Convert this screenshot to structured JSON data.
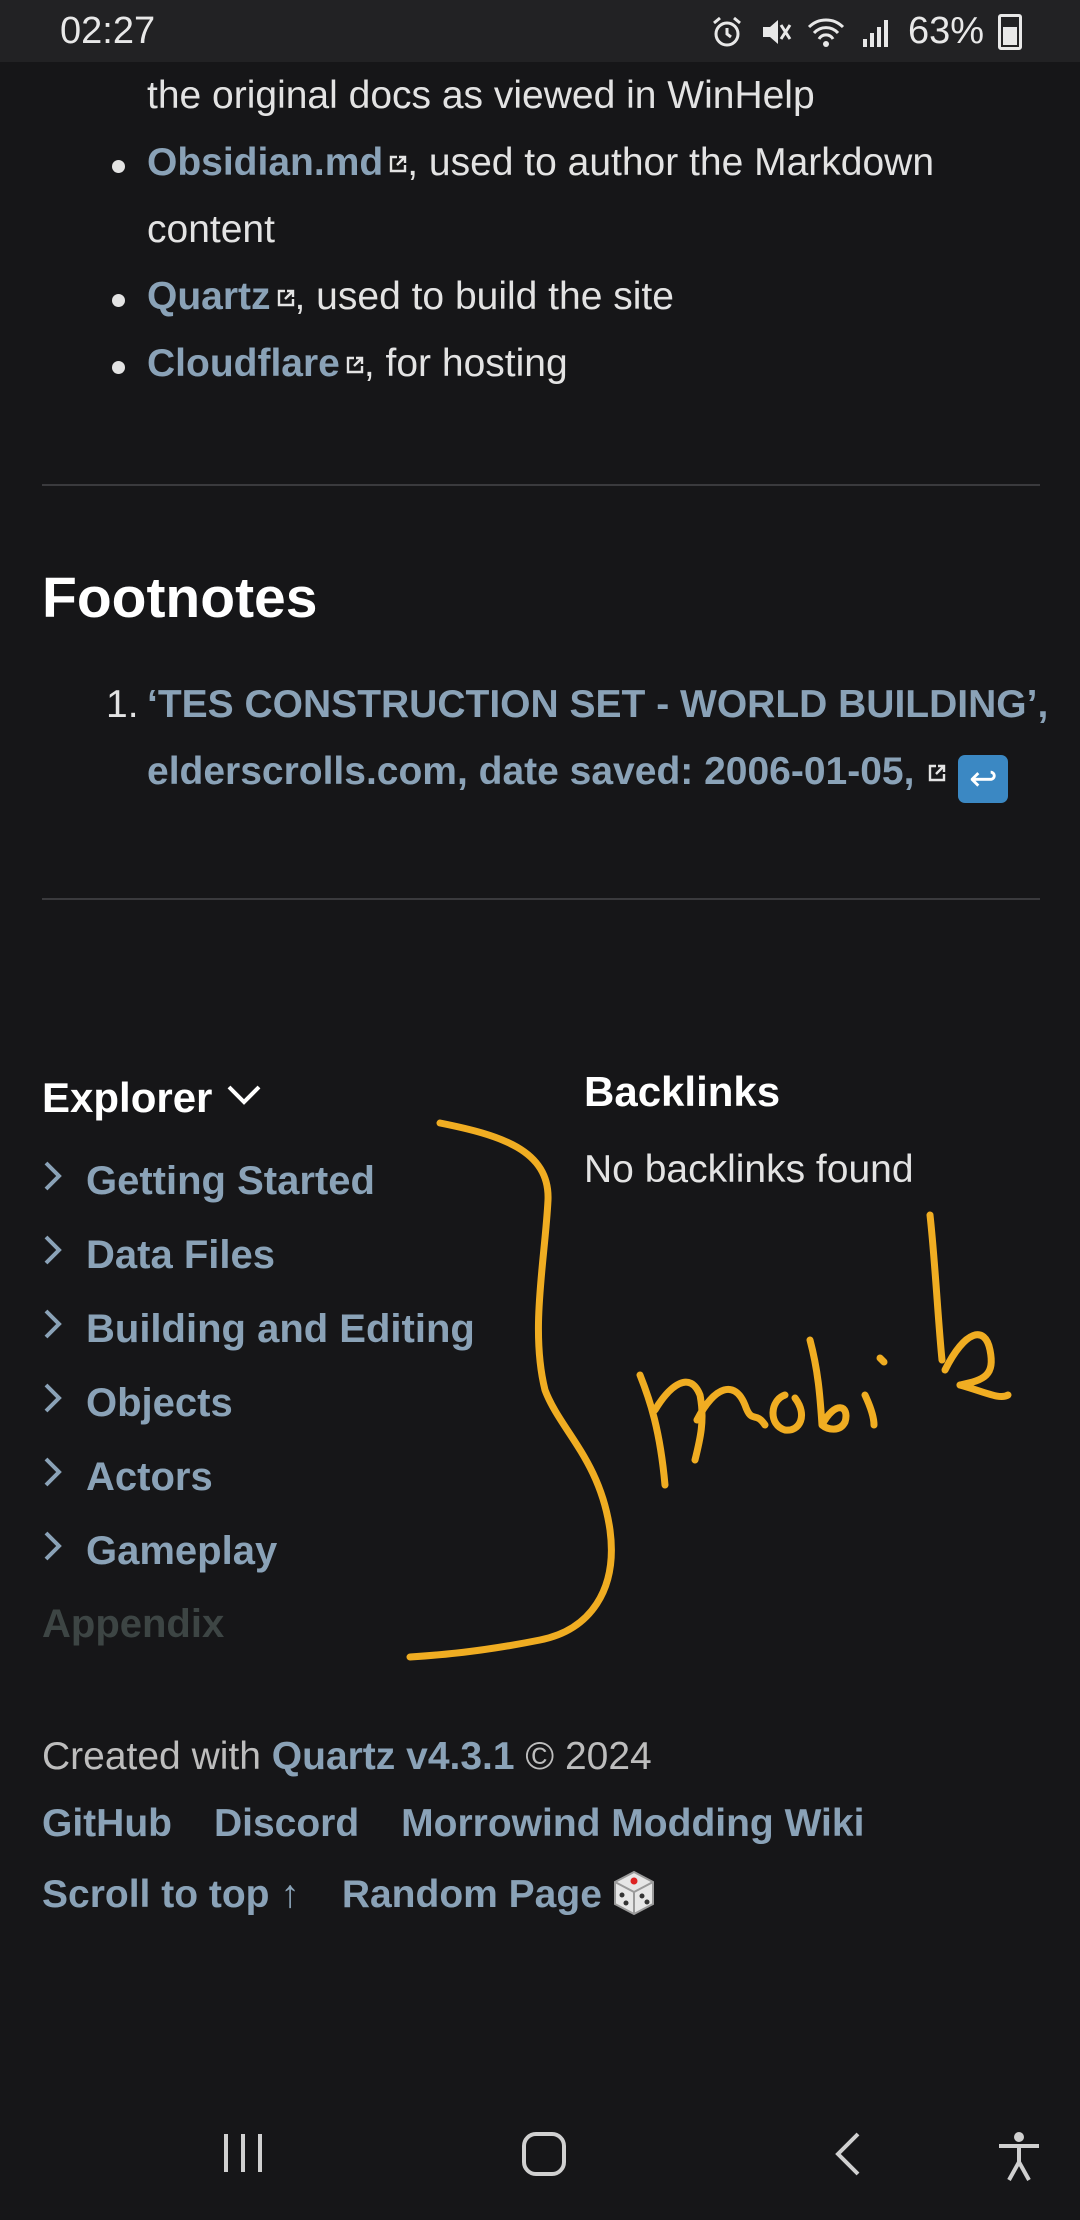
{
  "status_bar": {
    "time": "02:27",
    "battery": "63%",
    "icons": [
      "alarm-icon",
      "mute-icon",
      "wifi-icon",
      "signal-icon",
      "battery-icon"
    ]
  },
  "links_list": {
    "prev_line_text": "the original docs as viewed in WinHelp",
    "items": [
      {
        "link": "Obsidian.md",
        "text": ", used to author the Markdown",
        "text_cont": "content"
      },
      {
        "link": "Quartz",
        "text": ", used to build the site"
      },
      {
        "link": "Cloudflare",
        "text": ", for hosting"
      }
    ]
  },
  "footnotes": {
    "heading": "Footnotes",
    "number": "1.",
    "line1": "‘TES CONSTRUCTION SET - WORLD BUILDING’,",
    "line2": "elderscrolls.com, date saved: 2006-01-05,"
  },
  "explorer": {
    "title": "Explorer",
    "items": [
      "Getting Started",
      "Data Files",
      "Building and Editing",
      "Objects",
      "Actors",
      "Gameplay"
    ],
    "appendix": "Appendix"
  },
  "backlinks": {
    "title": "Backlinks",
    "empty_text": "No backlinks found"
  },
  "footer": {
    "created_prefix": "Created with ",
    "quartz_link": "Quartz v4.3.1",
    "created_suffix": " © 2024",
    "links": [
      "GitHub",
      "Discord",
      "Morrowind Modding Wiki"
    ],
    "scroll_to_top": "Scroll to top ↑",
    "random_page": "Random Page"
  },
  "annotation_color": "#f0ad22",
  "link_color": "#8aa2b7"
}
